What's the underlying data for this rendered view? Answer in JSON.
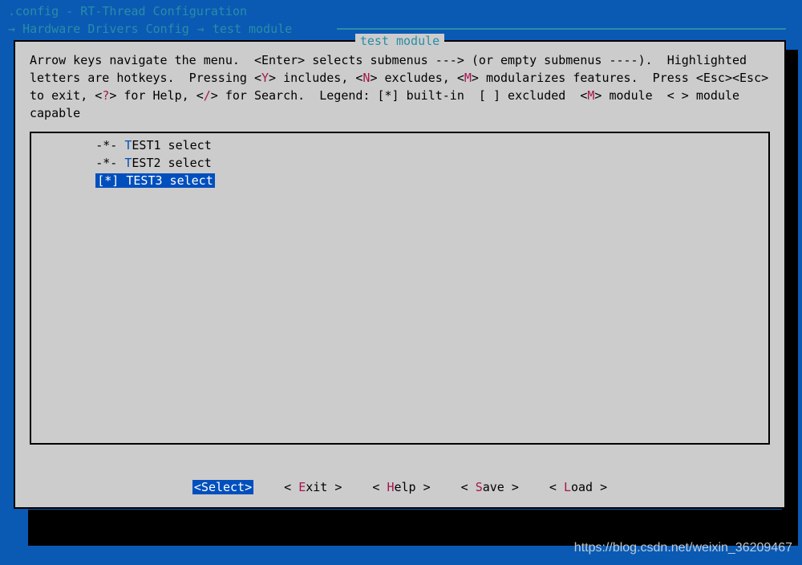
{
  "header": {
    "title_line": ".config - RT-Thread Configuration",
    "breadcrumb": {
      "seg1": "Hardware Drivers Config",
      "seg2": "test module"
    }
  },
  "box": {
    "title": "test module",
    "help_html": "Arrow keys navigate the menu.  &lt;Enter&gt; selects submenus ---&gt; (or empty submenus ----).  Highlighted letters are hotkeys.  Pressing &lt;Y&gt; includes, &lt;N&gt; excludes, &lt;M&gt; modularizes features.  Press &lt;Esc&gt;&lt;Esc&gt; to exit, &lt;?&gt; for Help, &lt;/&gt; for Search.  Legend: [*] built-in  [ ] excluded  &lt;M&gt; module  &lt; &gt; module capable"
  },
  "menu": {
    "items": [
      {
        "prefix": "-*-",
        "hotkey": "T",
        "rest": "EST1 select",
        "selected": false
      },
      {
        "prefix": "-*-",
        "hotkey": "T",
        "rest": "EST2 select",
        "selected": false
      },
      {
        "prefix": "[*]",
        "hotkey": "T",
        "rest": "EST3 select",
        "selected": true
      }
    ]
  },
  "buttons": [
    {
      "pre": "<",
      "hotkey": "S",
      "rest": "elect",
      "post": ">",
      "selected": true
    },
    {
      "pre": "< ",
      "hotkey": "E",
      "rest": "xit",
      "post": " >",
      "selected": false
    },
    {
      "pre": "< ",
      "hotkey": "H",
      "rest": "elp",
      "post": " >",
      "selected": false
    },
    {
      "pre": "< ",
      "hotkey": "S",
      "rest": "ave",
      "post": " >",
      "selected": false
    },
    {
      "pre": "< ",
      "hotkey": "L",
      "rest": "oad",
      "post": " >",
      "selected": false
    }
  ],
  "watermark": "https://blog.csdn.net/weixin_36209467"
}
